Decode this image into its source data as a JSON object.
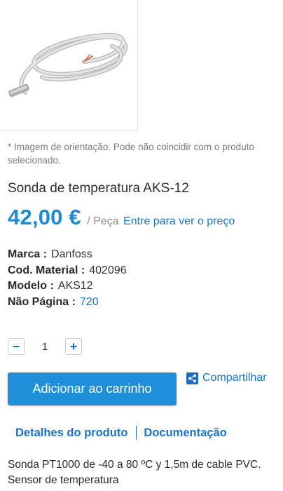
{
  "image_note": "* Imagem de orientação. Pode não coincidir com o produto selecionado.",
  "product": {
    "title": "Sonda de temperatura AKS-12",
    "price": "42,00 €",
    "per_unit": "/ Peça",
    "login_price_link": "Entre para ver o preço"
  },
  "specs": [
    {
      "label": "Marca :",
      "value": "Danfoss"
    },
    {
      "label": "Cod. Material :",
      "value": "402096"
    },
    {
      "label": "Modelo :",
      "value": "AKS12"
    },
    {
      "label": "Não Página :",
      "value": "720"
    }
  ],
  "quantity": {
    "minus": "−",
    "value": "1",
    "plus": "+"
  },
  "actions": {
    "add_to_cart": "Adicionar ao carrinho",
    "share": "Compartilhar"
  },
  "tabs": [
    "Detalhes do produto",
    "Documentação"
  ],
  "description": "Sonda PT1000 de -40 a 80 ºC y 1,5m de cable PVC. Sensor de temperatura",
  "colors": {
    "accent": "#1f8fdc",
    "link": "#1a73c9"
  },
  "icons": {
    "share": "share-icon",
    "product_image": "temperature-probe-cable"
  }
}
